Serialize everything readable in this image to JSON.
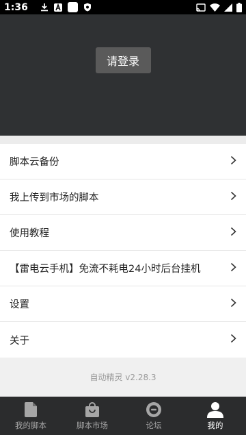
{
  "status_bar": {
    "time": "1:36",
    "icons_left": [
      "download-icon",
      "app-a-icon",
      "white-square-icon",
      "shield-icon"
    ],
    "icons_right": [
      "cast-icon",
      "wifi-icon",
      "signal-icon",
      "battery-icon"
    ]
  },
  "header": {
    "login_label": "请登录"
  },
  "menu": {
    "items": [
      {
        "label": "脚本云备份",
        "icon": "chevron-right-icon"
      },
      {
        "label": "我上传到市场的脚本",
        "icon": "chevron-right-icon"
      },
      {
        "label": "使用教程",
        "icon": "chevron-right-icon"
      },
      {
        "label": "【雷电云手机】免流不耗电24小时后台挂机",
        "icon": "chevron-right-icon"
      },
      {
        "label": "设置",
        "icon": "chevron-right-icon"
      },
      {
        "label": "关于",
        "icon": "chevron-right-icon"
      }
    ]
  },
  "version": "自动精灵 v2.28.3",
  "tabs": [
    {
      "label": "我的脚本",
      "icon": "file-icon",
      "active": false
    },
    {
      "label": "脚本市场",
      "icon": "shopping-bag-icon",
      "active": false
    },
    {
      "label": "论坛",
      "icon": "forum-icon",
      "active": false
    },
    {
      "label": "我的",
      "icon": "person-icon",
      "active": true
    }
  ],
  "colors": {
    "header_bg": "#2f3133",
    "tabbar_bg": "#2b2c2d",
    "active_tab": "#ffffff",
    "inactive_tab": "#a6a6a6"
  }
}
